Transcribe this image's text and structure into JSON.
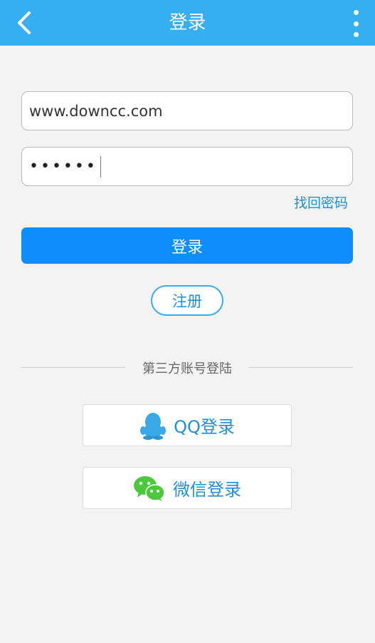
{
  "header": {
    "title": "登录",
    "back_icon": "chevron-left-icon",
    "menu_icon": "more-vertical-icon",
    "bar_color": "#35aef2"
  },
  "form": {
    "username": "www.downcc.com",
    "password_mask": "••••••",
    "forgot_label": "找回密码",
    "login_label": "登录",
    "register_label": "注册"
  },
  "third_party": {
    "divider_label": "第三方账号登陆",
    "qq_label": "QQ登录",
    "qq_icon": "qq-penguin-icon",
    "wechat_label": "微信登录",
    "wechat_icon": "wechat-icon"
  },
  "colors": {
    "primary": "#0f8dfb",
    "link": "#1e8fd8",
    "wechat_green": "#4cc83d",
    "qq_blue": "#39a9e8"
  }
}
